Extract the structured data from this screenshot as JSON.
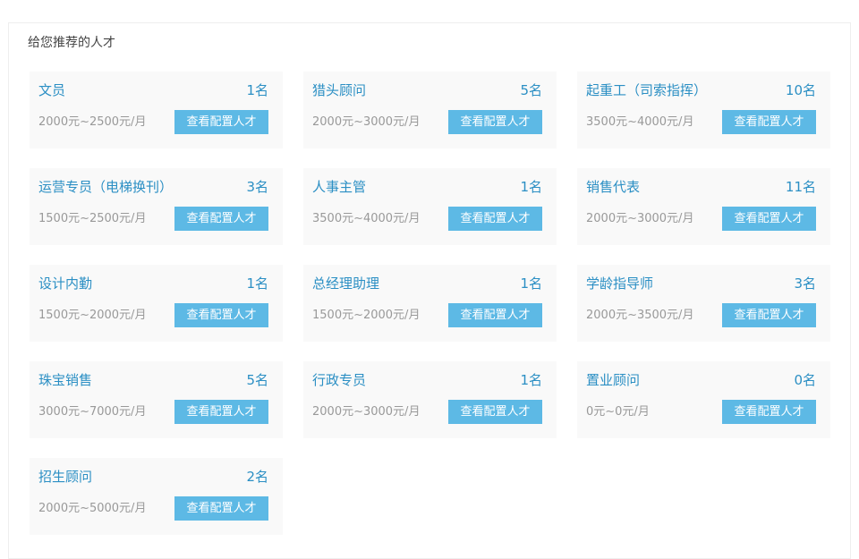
{
  "section": {
    "title": "给您推荐的人才",
    "button_label": "查看配置人才"
  },
  "colors": {
    "accent": "#2b8fc4",
    "button": "#5db9e5",
    "card_bg": "#f9f9f9",
    "muted_text": "#999999"
  },
  "cards": [
    {
      "title": "文员",
      "count": "1名",
      "salary": "2000元~2500元/月"
    },
    {
      "title": "猎头顾问",
      "count": "5名",
      "salary": "2000元~3000元/月"
    },
    {
      "title": "起重工（司索指挥）",
      "count": "10名",
      "salary": "3500元~4000元/月"
    },
    {
      "title": "运营专员（电梯换刊）",
      "count": "3名",
      "salary": "1500元~2500元/月"
    },
    {
      "title": "人事主管",
      "count": "1名",
      "salary": "3500元~4000元/月"
    },
    {
      "title": "销售代表",
      "count": "11名",
      "salary": "2000元~3000元/月"
    },
    {
      "title": "设计内勤",
      "count": "1名",
      "salary": "1500元~2000元/月"
    },
    {
      "title": "总经理助理",
      "count": "1名",
      "salary": "1500元~2000元/月"
    },
    {
      "title": "学龄指导师",
      "count": "3名",
      "salary": "2000元~3500元/月"
    },
    {
      "title": "珠宝销售",
      "count": "5名",
      "salary": "3000元~7000元/月"
    },
    {
      "title": "行政专员",
      "count": "1名",
      "salary": "2000元~3000元/月"
    },
    {
      "title": "置业顾问",
      "count": "0名",
      "salary": "0元~0元/月"
    },
    {
      "title": "招生顾问",
      "count": "2名",
      "salary": "2000元~5000元/月"
    }
  ]
}
